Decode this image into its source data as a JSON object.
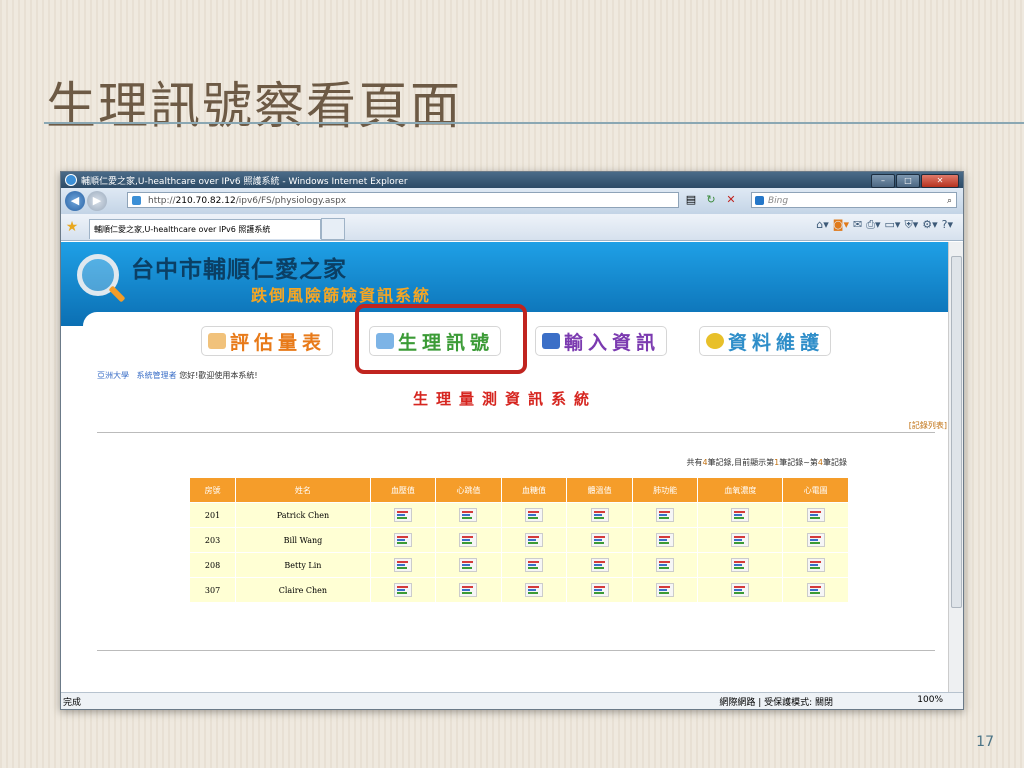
{
  "slide": {
    "title": "生理訊號察看頁面",
    "page_number": "17"
  },
  "browser": {
    "window_title": "輔順仁愛之家,U-healthcare over IPv6 照護系統 - Windows Internet Explorer",
    "url_prefix": "http://",
    "url_host": "210.70.82.12",
    "url_path": "/ipv6/FS/physiology.aspx",
    "search_placeholder": "Bing",
    "tab_title": "輔順仁愛之家,U-healthcare over IPv6 照護系統",
    "status_left": "完成",
    "status_zone": "網際網路 | 受保護模式: 關閉",
    "zoom": "100%"
  },
  "site": {
    "org_name": "台中市輔順仁愛之家",
    "system_name": "跌倒風險篩檢資訊系統",
    "menu": [
      {
        "label": "評估量表"
      },
      {
        "label": "生理訊號"
      },
      {
        "label": "輸入資訊"
      },
      {
        "label": "資料維護"
      }
    ],
    "welcome_org": "亞洲大學",
    "welcome_user": "系統管理者",
    "welcome_msg": "您好!歡迎使用本系統!",
    "page_heading": "生理量測資訊系統",
    "record_list_link": "[記錄列表]",
    "count_prefix": "共有",
    "count_total": "4",
    "count_mid": "筆記錄,目前顯示第",
    "count_from": "1",
    "count_to_text": "筆記錄~第",
    "count_to": "4",
    "count_suffix": "筆記錄"
  },
  "table": {
    "headers": [
      "房號",
      "姓名",
      "血壓值",
      "心跳值",
      "血糖值",
      "體溫值",
      "肺功能",
      "血氧濃度",
      "心電圖"
    ],
    "rows": [
      {
        "room": "201",
        "name": "Patrick Chen"
      },
      {
        "room": "203",
        "name": "Bill Wang"
      },
      {
        "room": "208",
        "name": "Betty Lin"
      },
      {
        "room": "307",
        "name": "Claire Chen"
      }
    ]
  }
}
